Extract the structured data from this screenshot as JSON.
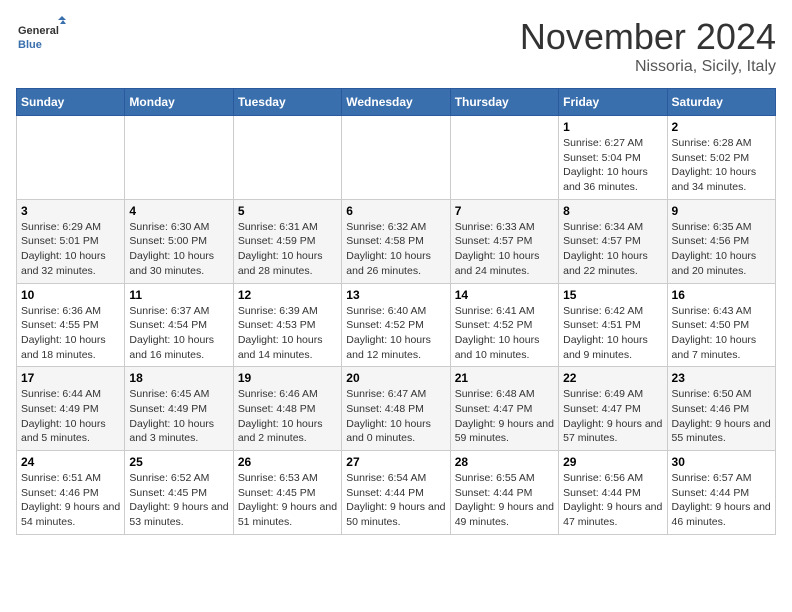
{
  "header": {
    "logo": {
      "general": "General",
      "blue": "Blue"
    },
    "month": "November 2024",
    "location": "Nissoria, Sicily, Italy"
  },
  "weekdays": [
    "Sunday",
    "Monday",
    "Tuesday",
    "Wednesday",
    "Thursday",
    "Friday",
    "Saturday"
  ],
  "weeks": [
    [
      {
        "day": "",
        "info": ""
      },
      {
        "day": "",
        "info": ""
      },
      {
        "day": "",
        "info": ""
      },
      {
        "day": "",
        "info": ""
      },
      {
        "day": "",
        "info": ""
      },
      {
        "day": "1",
        "info": "Sunrise: 6:27 AM\nSunset: 5:04 PM\nDaylight: 10 hours and 36 minutes."
      },
      {
        "day": "2",
        "info": "Sunrise: 6:28 AM\nSunset: 5:02 PM\nDaylight: 10 hours and 34 minutes."
      }
    ],
    [
      {
        "day": "3",
        "info": "Sunrise: 6:29 AM\nSunset: 5:01 PM\nDaylight: 10 hours and 32 minutes."
      },
      {
        "day": "4",
        "info": "Sunrise: 6:30 AM\nSunset: 5:00 PM\nDaylight: 10 hours and 30 minutes."
      },
      {
        "day": "5",
        "info": "Sunrise: 6:31 AM\nSunset: 4:59 PM\nDaylight: 10 hours and 28 minutes."
      },
      {
        "day": "6",
        "info": "Sunrise: 6:32 AM\nSunset: 4:58 PM\nDaylight: 10 hours and 26 minutes."
      },
      {
        "day": "7",
        "info": "Sunrise: 6:33 AM\nSunset: 4:57 PM\nDaylight: 10 hours and 24 minutes."
      },
      {
        "day": "8",
        "info": "Sunrise: 6:34 AM\nSunset: 4:57 PM\nDaylight: 10 hours and 22 minutes."
      },
      {
        "day": "9",
        "info": "Sunrise: 6:35 AM\nSunset: 4:56 PM\nDaylight: 10 hours and 20 minutes."
      }
    ],
    [
      {
        "day": "10",
        "info": "Sunrise: 6:36 AM\nSunset: 4:55 PM\nDaylight: 10 hours and 18 minutes."
      },
      {
        "day": "11",
        "info": "Sunrise: 6:37 AM\nSunset: 4:54 PM\nDaylight: 10 hours and 16 minutes."
      },
      {
        "day": "12",
        "info": "Sunrise: 6:39 AM\nSunset: 4:53 PM\nDaylight: 10 hours and 14 minutes."
      },
      {
        "day": "13",
        "info": "Sunrise: 6:40 AM\nSunset: 4:52 PM\nDaylight: 10 hours and 12 minutes."
      },
      {
        "day": "14",
        "info": "Sunrise: 6:41 AM\nSunset: 4:52 PM\nDaylight: 10 hours and 10 minutes."
      },
      {
        "day": "15",
        "info": "Sunrise: 6:42 AM\nSunset: 4:51 PM\nDaylight: 10 hours and 9 minutes."
      },
      {
        "day": "16",
        "info": "Sunrise: 6:43 AM\nSunset: 4:50 PM\nDaylight: 10 hours and 7 minutes."
      }
    ],
    [
      {
        "day": "17",
        "info": "Sunrise: 6:44 AM\nSunset: 4:49 PM\nDaylight: 10 hours and 5 minutes."
      },
      {
        "day": "18",
        "info": "Sunrise: 6:45 AM\nSunset: 4:49 PM\nDaylight: 10 hours and 3 minutes."
      },
      {
        "day": "19",
        "info": "Sunrise: 6:46 AM\nSunset: 4:48 PM\nDaylight: 10 hours and 2 minutes."
      },
      {
        "day": "20",
        "info": "Sunrise: 6:47 AM\nSunset: 4:48 PM\nDaylight: 10 hours and 0 minutes."
      },
      {
        "day": "21",
        "info": "Sunrise: 6:48 AM\nSunset: 4:47 PM\nDaylight: 9 hours and 59 minutes."
      },
      {
        "day": "22",
        "info": "Sunrise: 6:49 AM\nSunset: 4:47 PM\nDaylight: 9 hours and 57 minutes."
      },
      {
        "day": "23",
        "info": "Sunrise: 6:50 AM\nSunset: 4:46 PM\nDaylight: 9 hours and 55 minutes."
      }
    ],
    [
      {
        "day": "24",
        "info": "Sunrise: 6:51 AM\nSunset: 4:46 PM\nDaylight: 9 hours and 54 minutes."
      },
      {
        "day": "25",
        "info": "Sunrise: 6:52 AM\nSunset: 4:45 PM\nDaylight: 9 hours and 53 minutes."
      },
      {
        "day": "26",
        "info": "Sunrise: 6:53 AM\nSunset: 4:45 PM\nDaylight: 9 hours and 51 minutes."
      },
      {
        "day": "27",
        "info": "Sunrise: 6:54 AM\nSunset: 4:44 PM\nDaylight: 9 hours and 50 minutes."
      },
      {
        "day": "28",
        "info": "Sunrise: 6:55 AM\nSunset: 4:44 PM\nDaylight: 9 hours and 49 minutes."
      },
      {
        "day": "29",
        "info": "Sunrise: 6:56 AM\nSunset: 4:44 PM\nDaylight: 9 hours and 47 minutes."
      },
      {
        "day": "30",
        "info": "Sunrise: 6:57 AM\nSunset: 4:44 PM\nDaylight: 9 hours and 46 minutes."
      }
    ]
  ]
}
